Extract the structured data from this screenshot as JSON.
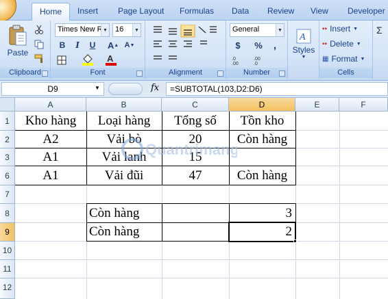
{
  "ribbon_tabs": [
    "Home",
    "Insert",
    "Page Layout",
    "Formulas",
    "Data",
    "Review",
    "View",
    "Developer"
  ],
  "ribbon": {
    "clipboard": {
      "label": "Clipboard",
      "paste": "Paste"
    },
    "font": {
      "label": "Font",
      "family": "Times New Ro",
      "size": "16",
      "bold": "B",
      "italic": "I",
      "underline": "U"
    },
    "alignment": {
      "label": "Alignment"
    },
    "number": {
      "label": "Number",
      "format": "General",
      "currency": "$",
      "percent": "%",
      "comma": ","
    },
    "styles": {
      "label": "Styles"
    },
    "cells": {
      "label": "Cells",
      "insert": "Insert",
      "delete": "Delete",
      "format": "Format"
    }
  },
  "formula_bar": {
    "name_box": "D9",
    "fx": "fx",
    "formula": "=SUBTOTAL(103,D2:D6)"
  },
  "columns": [
    "A",
    "B",
    "C",
    "D",
    "E",
    "F"
  ],
  "rows": [
    "1",
    "2",
    "3",
    "6",
    "7",
    "8",
    "9",
    "10",
    "11",
    "12"
  ],
  "cells": {
    "r1": [
      "Kho hàng",
      "Loại hàng",
      "Tổng số",
      "Tồn kho"
    ],
    "r2": [
      "A2",
      "Vải bò",
      "20",
      "Còn hàng"
    ],
    "r3": [
      "A1",
      "Vải lanh",
      "15",
      ""
    ],
    "r6": [
      "A1",
      "Vải đũi",
      "47",
      "Còn hàng"
    ],
    "r8": {
      "b": "Còn hàng",
      "d": "3"
    },
    "r9": {
      "b": "Còn hàng",
      "d": "2"
    }
  },
  "watermark": "Quantrimang",
  "colors": {
    "ribbon": "#dbe8f8",
    "selected_header": "#f4c86a",
    "gridline": "#d0d7e5"
  }
}
